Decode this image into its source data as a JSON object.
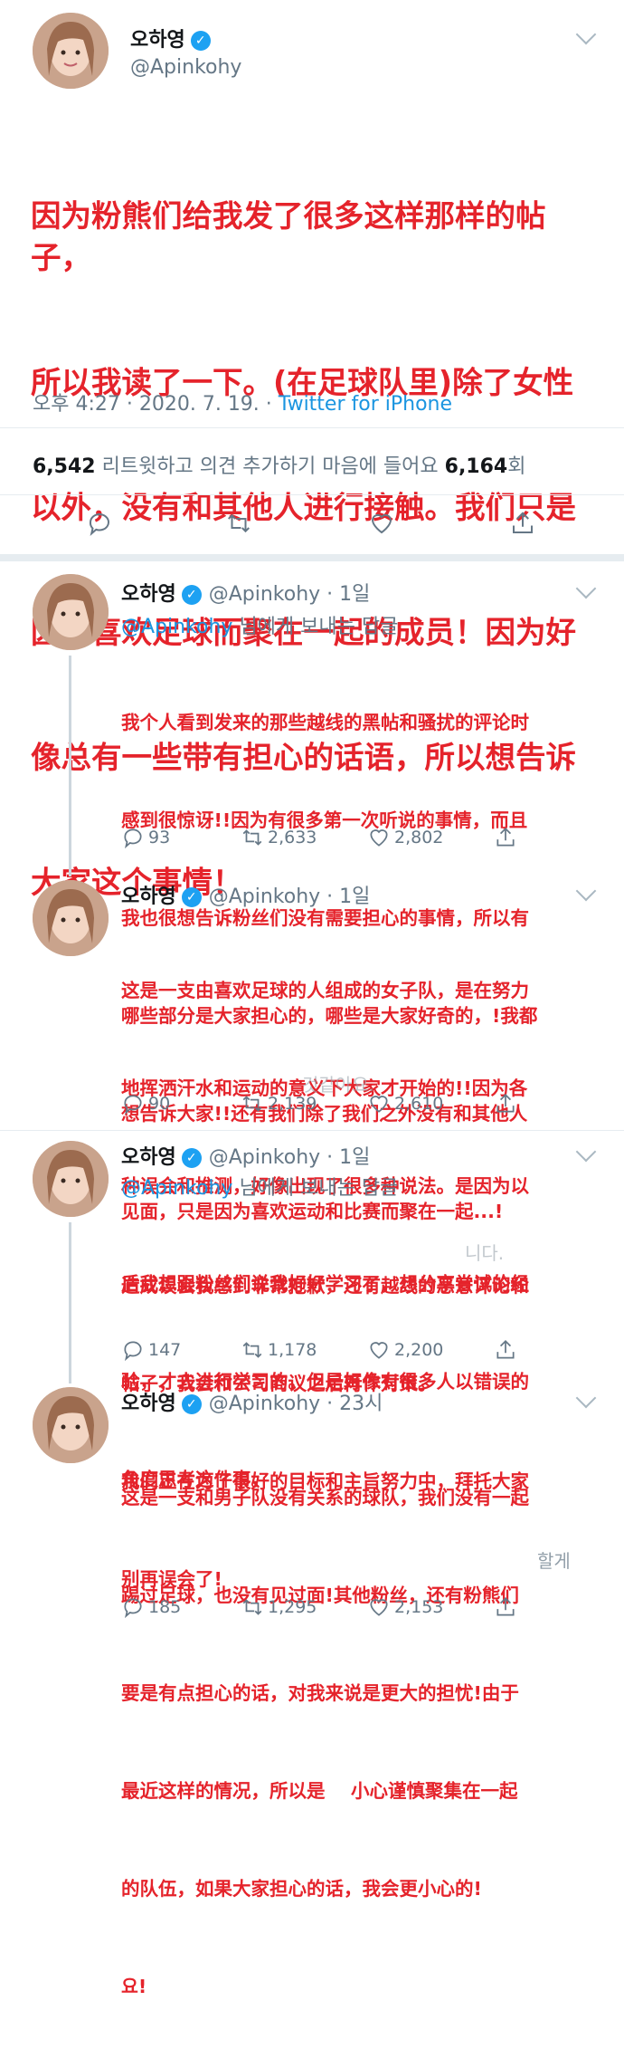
{
  "main": {
    "name": "오하영",
    "handle": "@Apinkohy",
    "text_lines": [
      "因为粉熊们给我发了很多这样那样的帖子，",
      "所以我读了一下。(在足球队里)除了女性",
      "以外，没有和其他人进行接触。我们只是",
      "因为喜欢足球而聚在一起的成员！因为好",
      "像总有一些带有担心的话语，所以想告诉",
      "大家这个事情！"
    ],
    "time": "오후 4:27 · 2020. 7. 19. · ",
    "source": "Twitter for iPhone",
    "retweets_count": "6,542",
    "retweets_label": " 리트윗하고 의견 추가하기  마음에 들어요 ",
    "likes_count": "6,164",
    "likes_suffix": "회"
  },
  "replies": [
    {
      "name": "오하영",
      "handle": "@Apinkohy · 1일",
      "reply_to_mention": "@Apinkohy",
      "reply_to_suffix": " 님에게 보내는 답글",
      "text_lines": [
        "我个人看到发来的那些越线的黑帖和骚扰的评论时",
        "感到很惊讶!!因为有很多第一次听说的事情，而且",
        "我也很想告诉粉丝们没有需要担心的事情，所以有",
        "哪些部分是大家担心的，哪些是大家好奇的，!我都",
        "想告诉大家!!还有我们除了我们之外没有和其他人",
        "见面，只是因为喜欢运动和比赛而聚在一起...!"
      ],
      "replies": "93",
      "retweets": "2,633",
      "likes": "2,802"
    },
    {
      "name": "오하영",
      "handle": "@Apinkohy · 1일",
      "reply_to_mention": "",
      "reply_to_suffix": "",
      "text_lines": [
        "这是一支由喜欢足球的人组成的女子队，是在努力",
        "地挥洒汗水和运动的意义下大家才开始的!!因为各",
        "种误会和推测，好像出现了很多种说法。是因为以",
        "后我想跟粉丝们说我好好学习了，想分享尝试的经",
        "验，才去进行学习的。但是好像有很多人以错误的",
        "角度思考这件事。"
      ],
      "ghost": "것같아요.",
      "replies": "90",
      "retweets": "2,139",
      "likes": "2,610"
    },
    {
      "name": "오하영",
      "handle": "@Apinkohy · 1일",
      "reply_to_mention": "@Apinkohy",
      "reply_to_suffix": " 님에게 보내는 답글",
      "text_lines": [
        "造成误会我感到非常抱歉，还有越线的恶意评论和",
        "帖子，我会和公司商议之后再作对策。",
        "我们正在为了很好的目标和主旨努力中，拜托大家",
        "别再误会了!"
      ],
      "ghost": "니다.",
      "replies": "147",
      "retweets": "1,178",
      "likes": "2,200"
    },
    {
      "name": "오하영",
      "handle": "@Apinkohy · 23시",
      "reply_to_mention": "",
      "reply_to_suffix": "",
      "text_lines": [
        "这是一支和男子队没有关系的球队，我们没有一起",
        "踢过足球，也没有见过面!其他粉丝，还有粉熊们",
        "要是有点担心的话，对我来说是更大的担忧!由于",
        "最近这样的情况，所以是    小心谨慎聚集在一起",
        "的队伍，如果大家担心的话，我会更小心的!",
        "요!"
      ],
      "ghost": "할게",
      "replies": "185",
      "retweets": "1,295",
      "likes": "2,153"
    }
  ],
  "colors": {
    "overlay_red": "#e5232b",
    "link_blue": "#1b95e0",
    "gray": "#657786"
  }
}
